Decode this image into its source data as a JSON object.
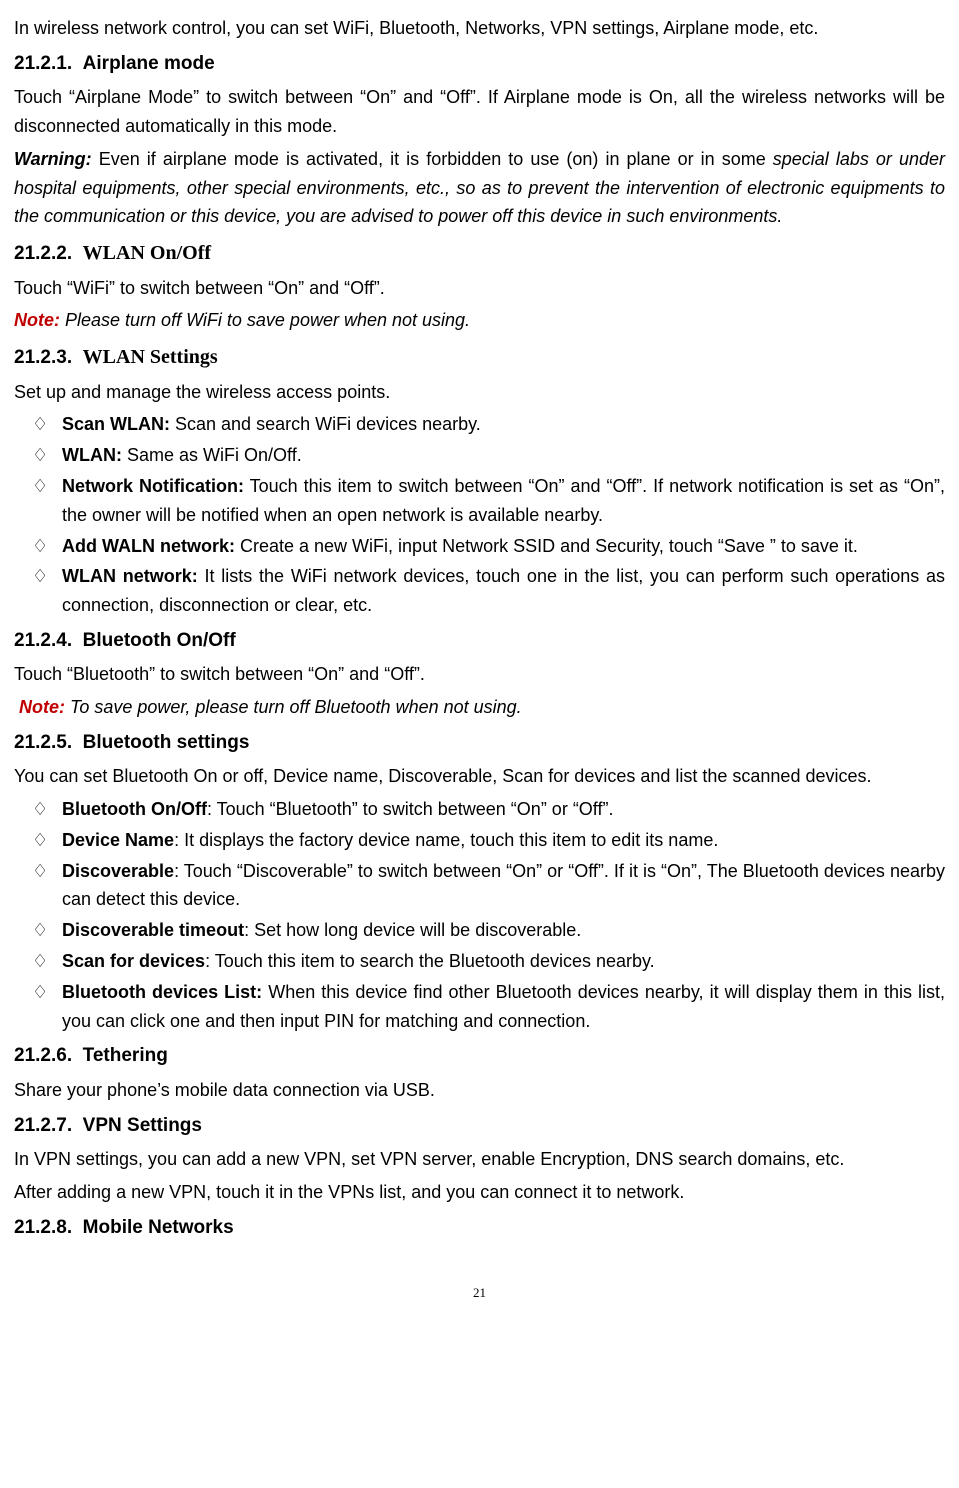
{
  "intro": "In wireless network control, you can set WiFi, Bluetooth, Networks, VPN settings, Airplane mode, etc.",
  "s1": {
    "num": "21.2.1.",
    "title": "Airplane mode",
    "p1": "Touch “Airplane Mode” to switch between “On” and “Off”. If Airplane mode is On, all the wireless networks will be disconnected automatically in this mode.",
    "warnLabel": "Warning:",
    "warnA": " Even if airplane mode is activated, it is forbidden to use (on) in plane or in some ",
    "warnB": "special labs or under hospital equipments, other special environments, etc., so as to prevent the intervention of electronic equipments to the communication or this device, you are advised to power off this device in such environments."
  },
  "s2": {
    "num": "21.2.2.",
    "title": "WLAN On/Off",
    "p1": "Touch “WiFi” to switch between “On” and “Off”.",
    "noteLabel": "Note:",
    "note": " Please turn off WiFi to save power when not using."
  },
  "s3": {
    "num": "21.2.3.",
    "title": "WLAN Settings",
    "p1": "Set up and manage the wireless access points.",
    "items": [
      {
        "b": "Scan WLAN:",
        "t": " Scan and search WiFi devices nearby."
      },
      {
        "b": "WLAN:",
        "t": " Same as WiFi On/Off."
      },
      {
        "b": "Network Notification:",
        "t": " Touch this item to switch between “On” and “Off”. If network notification is set as “On”, the owner will be notified when an open network is available nearby."
      },
      {
        "b": "Add WALN network:",
        "t": " Create a new WiFi, input Network SSID and Security, touch “Save ” to save it."
      },
      {
        "b": "WLAN network:",
        "t": " It lists the WiFi network devices, touch one in the list, you can perform such operations as connection, disconnection or clear, etc."
      }
    ]
  },
  "s4": {
    "num": "21.2.4.",
    "title": "Bluetooth On/Off",
    "p1": "Touch “Bluetooth” to switch between “On” and “Off”.",
    "noteLabel": "Note:",
    "note": " To save power, please turn off Bluetooth when not using."
  },
  "s5": {
    "num": "21.2.5.",
    "title": "Bluetooth settings",
    "p1": "You can set Bluetooth On or off, Device name, Discoverable, Scan for devices and list the scanned devices.",
    "items": [
      {
        "b": "Bluetooth On/Off",
        "t": ": Touch “Bluetooth” to switch between “On” or “Off”."
      },
      {
        "b": "Device Name",
        "t": ": It displays the factory device name, touch this item to edit its name."
      },
      {
        "b": "Discoverable",
        "t": ": Touch “Discoverable” to switch between “On” or “Off”. If it is “On”, The Bluetooth devices nearby can detect this device."
      },
      {
        "b": "Discoverable timeout",
        "t": ": Set how long device will be discoverable."
      },
      {
        "b": "Scan for devices",
        "t": ": Touch this item to search the Bluetooth devices nearby."
      },
      {
        "b": "Bluetooth devices List:",
        "t": " When this device find other Bluetooth devices nearby, it will display them in this list, you can click one and then input PIN for matching and connection."
      }
    ]
  },
  "s6": {
    "num": "21.2.6.",
    "title": "Tethering",
    "p1": "Share your phone’s mobile data connection via USB."
  },
  "s7": {
    "num": "21.2.7.",
    "title": "VPN Settings",
    "p1": "In VPN settings, you can add a new VPN, set VPN server, enable Encryption, DNS search domains, etc.",
    "p2": "After adding a new VPN, touch it in the VPNs list, and you can connect it to network."
  },
  "s8": {
    "num": "21.2.8.",
    "title": "Mobile Networks"
  },
  "pageNumber": "21"
}
